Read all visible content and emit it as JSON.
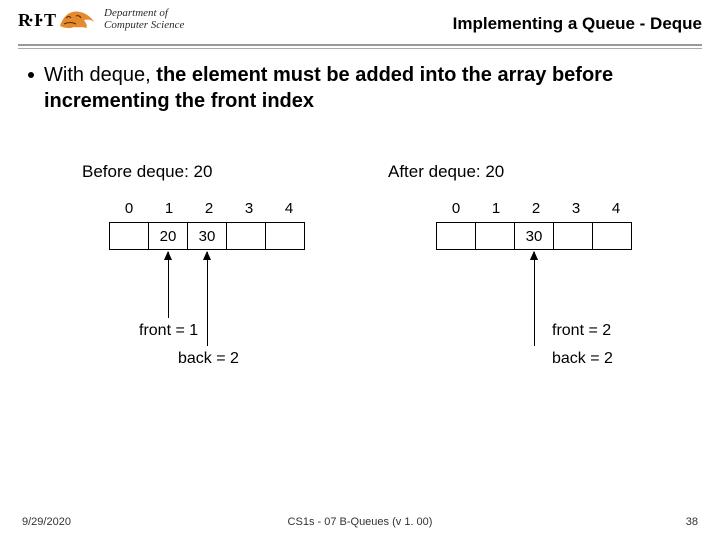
{
  "header": {
    "rit": "R·I·T",
    "dept_line1": "Department of",
    "dept_line2": "Computer Science",
    "title": "Implementing a Queue - Deque"
  },
  "bullet": {
    "lead": "With deque, ",
    "bold": "the element must be added into the array before incrementing the front index"
  },
  "before": {
    "caption": "Before deque: 20",
    "indices": [
      "0",
      "1",
      "2",
      "3",
      "4"
    ],
    "cells": [
      "",
      "20",
      "30",
      "",
      ""
    ],
    "front_label": "front = 1",
    "back_label": "back = 2"
  },
  "after": {
    "caption": "After deque: 20",
    "indices": [
      "0",
      "1",
      "2",
      "3",
      "4"
    ],
    "cells": [
      "",
      "",
      "30",
      "",
      ""
    ],
    "front_label": "front = 2",
    "back_label": "back = 2"
  },
  "footer": {
    "date": "9/29/2020",
    "mid": "CS1s - 07 B-Queues (v 1. 00)",
    "page": "38"
  }
}
